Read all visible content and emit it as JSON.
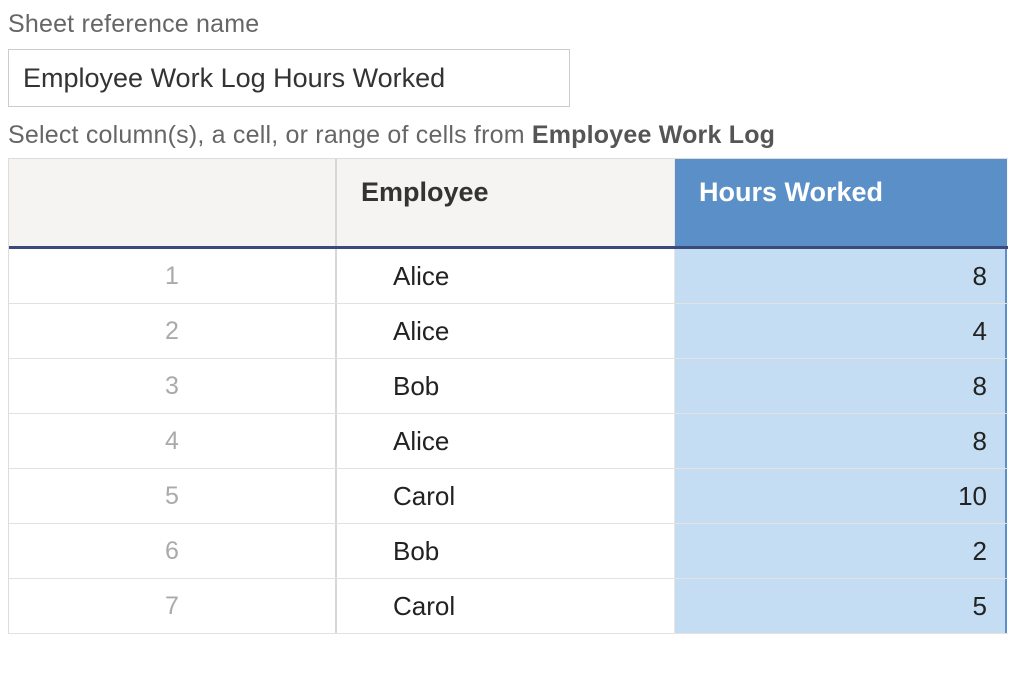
{
  "field_label": "Sheet reference name",
  "input_value": "Employee Work Log Hours Worked",
  "instruction_prefix": "Select column(s), a cell, or range of cells from ",
  "instruction_bold": "Employee Work Log",
  "headers": {
    "employee": "Employee",
    "hours": "Hours Worked"
  },
  "rows": [
    {
      "n": "1",
      "employee": "Alice",
      "hours": "8"
    },
    {
      "n": "2",
      "employee": "Alice",
      "hours": "4"
    },
    {
      "n": "3",
      "employee": "Bob",
      "hours": "8"
    },
    {
      "n": "4",
      "employee": "Alice",
      "hours": "8"
    },
    {
      "n": "5",
      "employee": "Carol",
      "hours": "10"
    },
    {
      "n": "6",
      "employee": "Bob",
      "hours": "2"
    },
    {
      "n": "7",
      "employee": "Carol",
      "hours": "5"
    }
  ]
}
